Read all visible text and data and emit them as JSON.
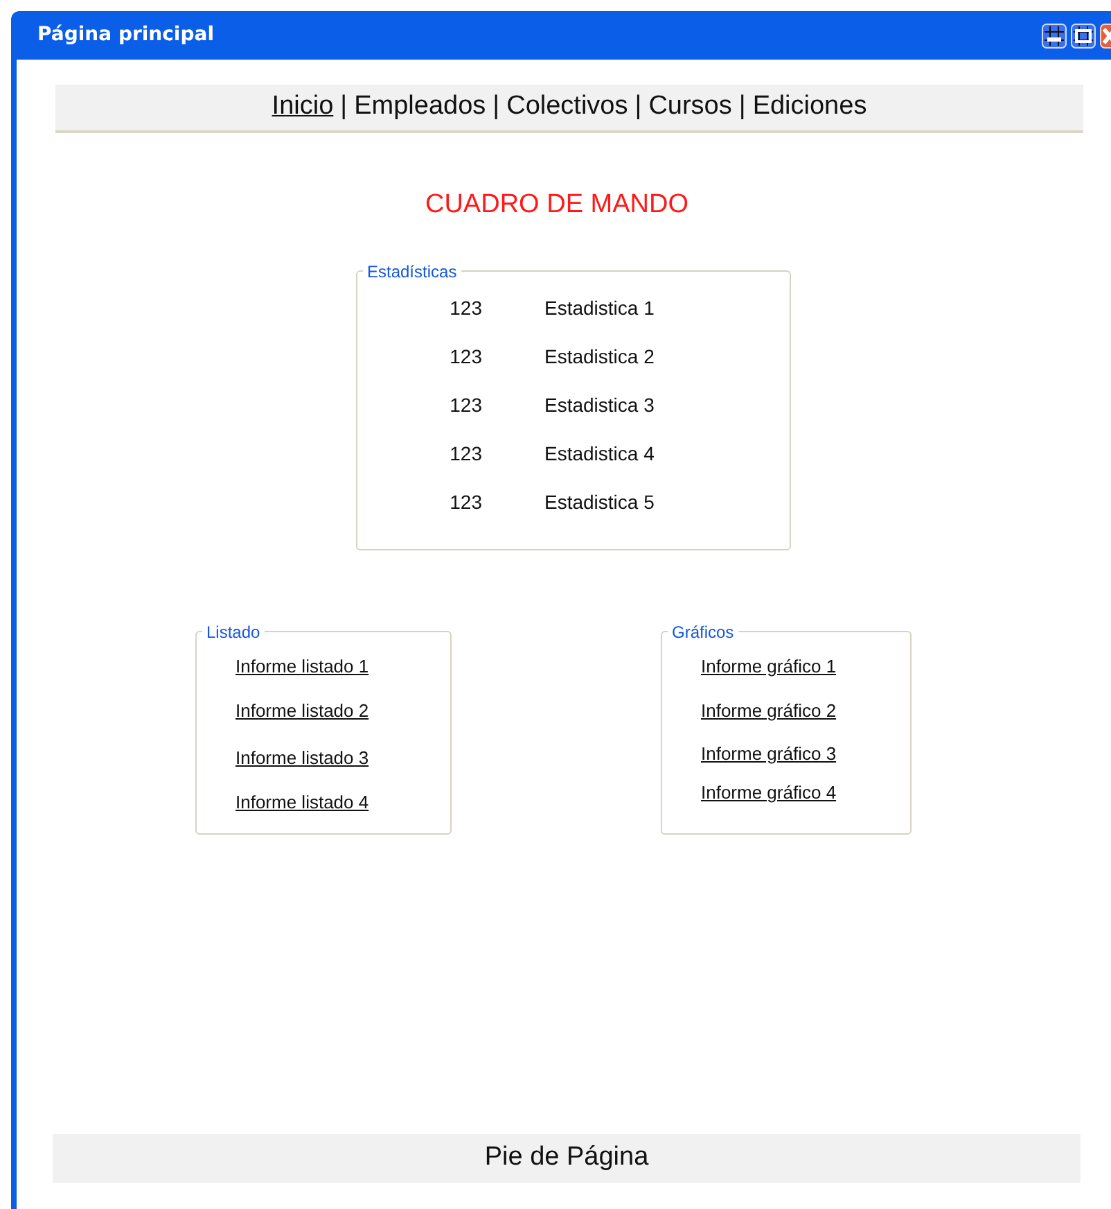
{
  "window": {
    "title": "Página principal"
  },
  "nav": {
    "separator": "|",
    "items": [
      {
        "label": "Inicio",
        "selected": true
      },
      {
        "label": "Empleados",
        "selected": false
      },
      {
        "label": "Colectivos",
        "selected": false
      },
      {
        "label": "Cursos",
        "selected": false
      },
      {
        "label": "Ediciones",
        "selected": false
      }
    ]
  },
  "heading": "CUADRO DE MANDO",
  "stats": {
    "legend": "Estadísticas",
    "rows": [
      {
        "value": "123",
        "label": "Estadistica 1"
      },
      {
        "value": "123",
        "label": "Estadistica 2"
      },
      {
        "value": "123",
        "label": "Estadistica 3"
      },
      {
        "value": "123",
        "label": "Estadistica 4"
      },
      {
        "value": "123",
        "label": "Estadistica 5"
      }
    ]
  },
  "listado": {
    "legend": "Listado",
    "links": [
      "Informe listado 1",
      "Informe listado 2",
      "Informe listado 3",
      "Informe listado 4"
    ]
  },
  "graficos": {
    "legend": "Gráficos",
    "links": [
      "Informe gráfico 1",
      "Informe gráfico 2",
      "Informe gráfico 3",
      "Informe gráfico 4"
    ]
  },
  "footer": "Pie de Página"
}
